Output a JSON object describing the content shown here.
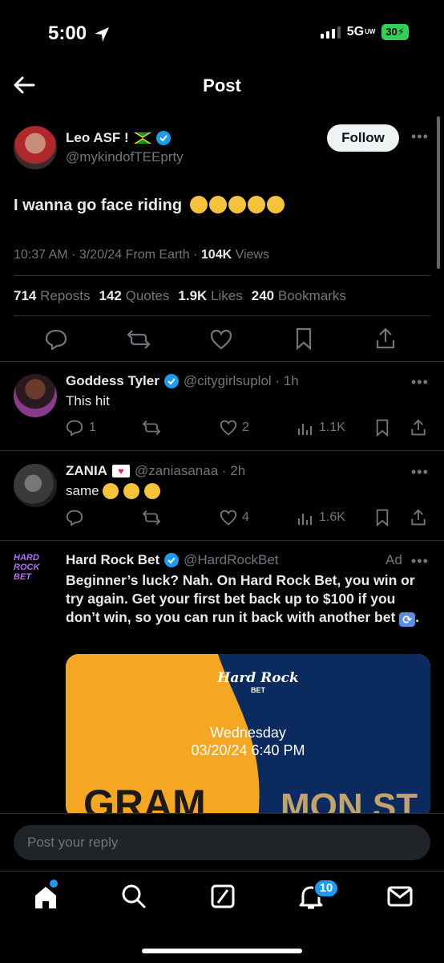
{
  "status_bar": {
    "time": "5:00",
    "network": "5G",
    "network_sub": "UW",
    "battery": "30"
  },
  "header": {
    "title": "Post"
  },
  "post": {
    "author_name": "Leo ASF !",
    "handle": "@mykindofTEEprty",
    "follow_label": "Follow",
    "text": "I wanna go face riding",
    "meta_time": "10:37 AM · 3/20/24 From Earth ·",
    "views_count": "104K",
    "views_label": "Views",
    "stats": [
      {
        "count": "714",
        "label": "Reposts"
      },
      {
        "count": "142",
        "label": "Quotes"
      },
      {
        "count": "1.9K",
        "label": "Likes"
      },
      {
        "count": "240",
        "label": "Bookmarks"
      }
    ]
  },
  "replies": [
    {
      "name": "Goddess Tyler",
      "handle": "@citygirlsuplol · 1h",
      "text": "This hit",
      "replies": "1",
      "likes": "2",
      "views": "1.1K"
    },
    {
      "name": "ZANIA",
      "handle": "@zaniasanaa · 2h",
      "text": "same",
      "replies": "",
      "likes": "4",
      "views": "1.6K"
    }
  ],
  "ad": {
    "name": "Hard Rock Bet",
    "handle": "@HardRockBet",
    "label": "Ad",
    "avatar_text": "HARD ROCK BET",
    "text": "Beginner’s luck? Nah. On Hard Rock Bet, you win or try again. Get your first bet back up to $100 if you don’t win, so you can run it back with another bet",
    "card": {
      "logo_line1": "Hard Rock",
      "logo_line2": "BET",
      "day": "Wednesday",
      "datetime": "03/20/24 6:40 PM",
      "team_left": "GRAM",
      "team_right": "MON ST",
      "color_left": "#f5a623",
      "color_right": "#0b2a5e"
    }
  },
  "reply_box": {
    "placeholder": "Post your reply"
  },
  "tabbar": {
    "notifications_badge": "10"
  },
  "colors": {
    "accent": "#1d9bf0",
    "muted": "#71767b",
    "background": "#000000"
  }
}
